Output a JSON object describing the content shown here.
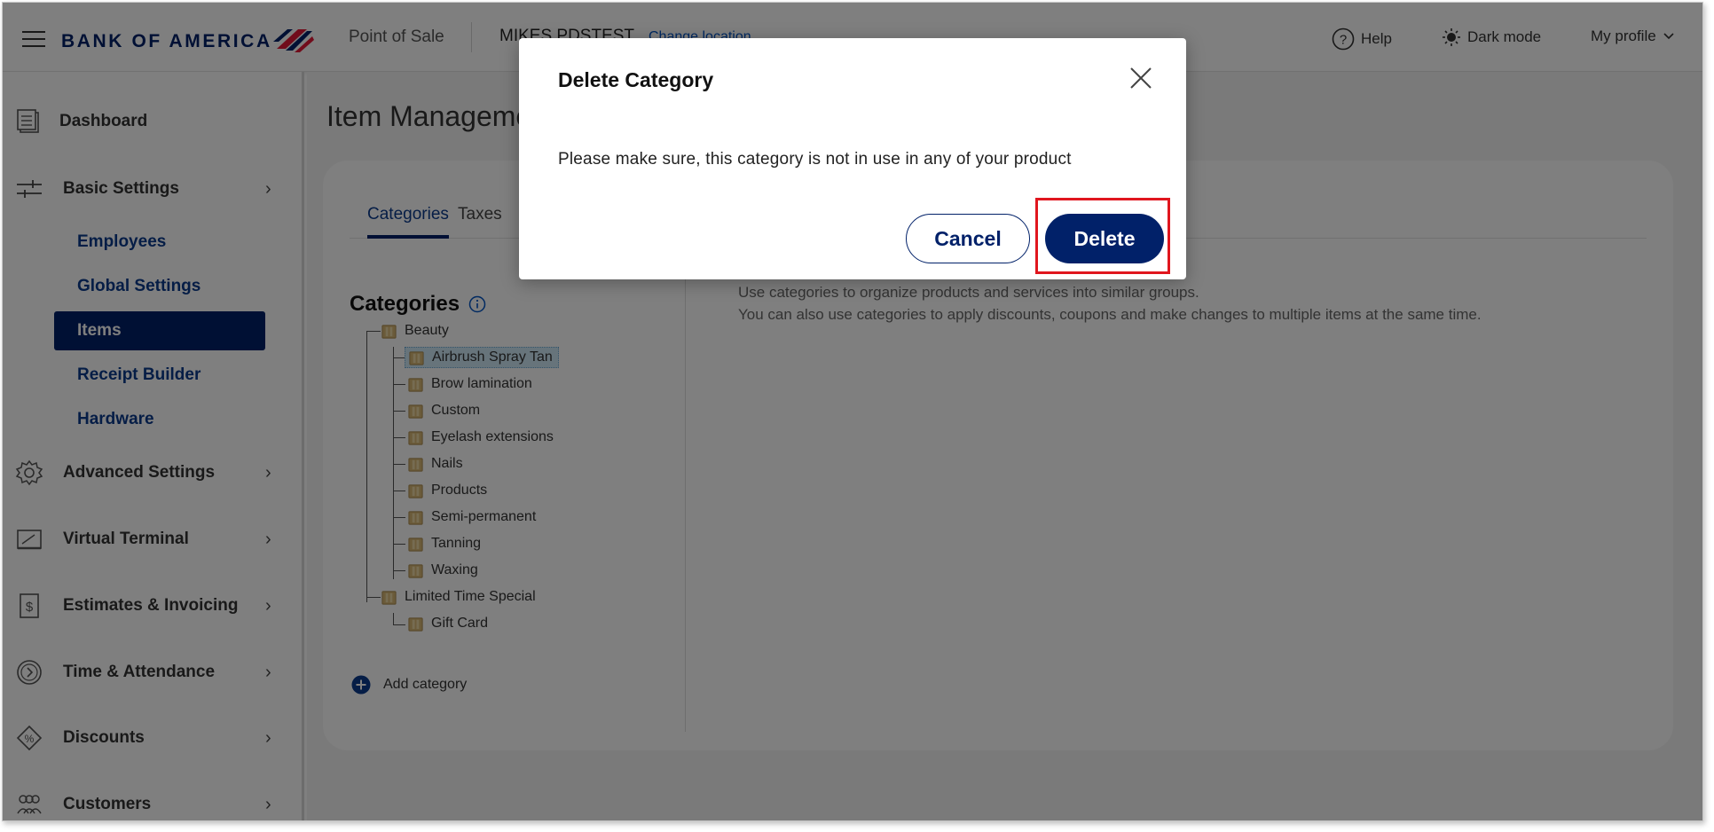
{
  "header": {
    "brand": "BANK OF AMERICA",
    "app_name": "Point of Sale",
    "location_name": "MIKES PDSTEST",
    "change_location": "Change location",
    "help": "Help",
    "dark_mode": "Dark mode",
    "profile": "My profile"
  },
  "sidebar": {
    "dashboard": "Dashboard",
    "basic_settings": "Basic Settings",
    "sub_items": [
      "Employees",
      "Global Settings",
      "Items",
      "Receipt Builder",
      "Hardware"
    ],
    "active_sub_item": "Items",
    "advanced_settings": "Advanced Settings",
    "virtual_terminal": "Virtual Terminal",
    "estimates_invoicing": "Estimates & Invoicing",
    "time_attendance": "Time & Attendance",
    "discounts": "Discounts",
    "customers": "Customers"
  },
  "main": {
    "page_title": "Item Management",
    "tabs": [
      "Categories",
      "Taxes"
    ],
    "active_tab": "Categories",
    "categories_heading": "Categories",
    "description_line1": "Use categories to organize products and services into similar groups.",
    "description_line2": "You can also use categories to apply discounts, coupons and make changes to multiple items at the same time.",
    "tree": {
      "group1": "Beauty",
      "group1_children": [
        "Airbrush Spray Tan",
        "Brow lamination",
        "Custom",
        "Eyelash extensions",
        "Nails",
        "Products",
        "Semi-permanent",
        "Tanning",
        "Waxing"
      ],
      "selected": "Airbrush Spray Tan",
      "group2": "Limited Time Special",
      "group2_children": [
        "Gift Card"
      ]
    },
    "add_category": "Add category"
  },
  "modal": {
    "title": "Delete Category",
    "message": "Please make sure, this category is not in use in any of your product",
    "cancel_label": "Cancel",
    "delete_label": "Delete"
  },
  "colors": {
    "brand_navy": "#012169",
    "link_blue": "#0052c2",
    "highlight_red": "#e0161e",
    "selected_node": "#cfe8f7"
  },
  "icons": {
    "menu": "hamburger-icon",
    "help": "question-circle-icon",
    "dark_mode": "sun-icon",
    "close": "close-icon",
    "folder": "folder-icon"
  }
}
